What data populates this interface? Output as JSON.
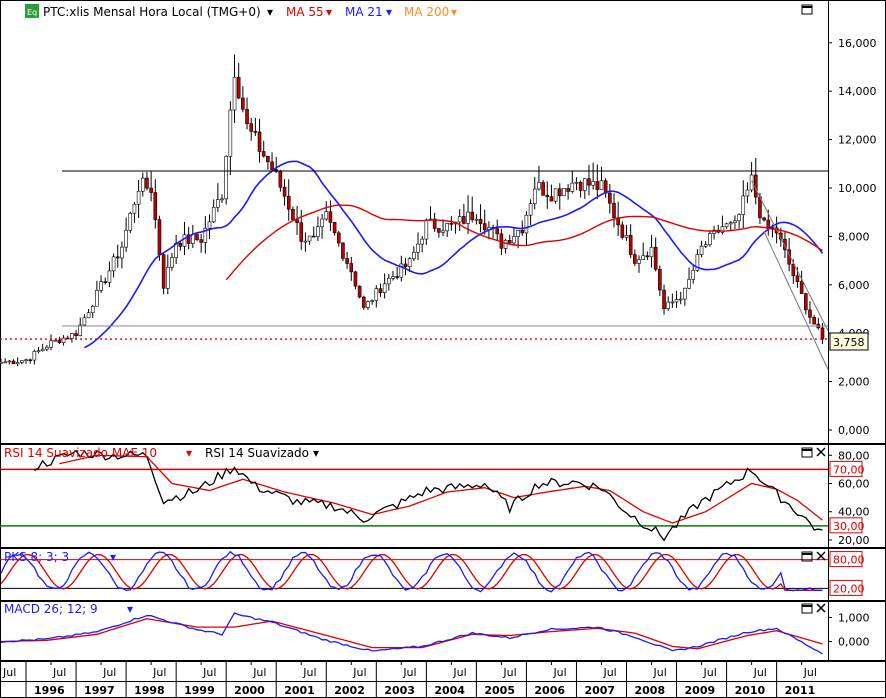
{
  "header": {
    "symbol_badge": "Eq",
    "title": "PTC:xlis Mensal Hora Local (TMG+0)",
    "ma55_label": "MA 55",
    "ma21_label": "MA 21",
    "ma200_label": "MA 200",
    "dropdown_glyph": "▾"
  },
  "price_panel": {
    "last_price_label": "3,758",
    "y_ticks": [
      "16,000",
      "14,000",
      "12,000",
      "10,000",
      "8,000",
      "6,000",
      "4,000",
      "2,000",
      "0,000"
    ]
  },
  "rsi_panel": {
    "label_mae": "RSI 14 Suavizado MAE 10",
    "label_rsi": "RSI 14 Suavizado",
    "y_ticks": [
      "80,00",
      "60,00",
      "40,00",
      "20,00"
    ],
    "levels": [
      "70,00",
      "30,00"
    ]
  },
  "pks_panel": {
    "label": "PKS 8; 3; 3",
    "levels": [
      "80,00",
      "20,00"
    ]
  },
  "macd_panel": {
    "label": "MACD 26; 12; 9",
    "y_ticks": [
      "1,000",
      "0,000"
    ]
  },
  "time_axis": {
    "years": [
      "1996",
      "1997",
      "1998",
      "1999",
      "2000",
      "2001",
      "2002",
      "2003",
      "2004",
      "2005",
      "2006",
      "2007",
      "2008",
      "2009",
      "2010",
      "2011"
    ],
    "mid_year_label": "Jul"
  },
  "colors": {
    "ma55": "#e00000",
    "ma21": "#1a1aff",
    "ma200": "#ff8c1a",
    "candle_up": "#ffffff",
    "candle_down": "#c00000",
    "level_red": "#e00000",
    "level_green": "#008000"
  },
  "chart_data": [
    {
      "type": "candlestick",
      "title": "PTC:xlis Mensal Hora Local (TMG+0)",
      "frequency": "monthly",
      "x_start": "1995-07",
      "x_end": "2011-12",
      "ylim": [
        0,
        16.5
      ],
      "horizontal_lines": [
        10.7,
        4.3,
        3.758
      ],
      "last_price": 3.758,
      "close_anchors": [
        {
          "date": "1995-07",
          "close": 2.8
        },
        {
          "date": "1996-01",
          "close": 2.9
        },
        {
          "date": "1996-07",
          "close": 3.6
        },
        {
          "date": "1997-01",
          "close": 4.0
        },
        {
          "date": "1997-06",
          "close": 5.6
        },
        {
          "date": "1997-12",
          "close": 7.6
        },
        {
          "date": "1998-04",
          "close": 10.1
        },
        {
          "date": "1998-07",
          "close": 10.0
        },
        {
          "date": "1998-10",
          "close": 6.0
        },
        {
          "date": "1999-01",
          "close": 7.8
        },
        {
          "date": "1999-07",
          "close": 7.9
        },
        {
          "date": "1999-12",
          "close": 9.8
        },
        {
          "date": "2000-03",
          "close": 15.0
        },
        {
          "date": "2000-06",
          "close": 12.5
        },
        {
          "date": "2000-12",
          "close": 10.8
        },
        {
          "date": "2001-03",
          "close": 9.7
        },
        {
          "date": "2001-07",
          "close": 8.0
        },
        {
          "date": "2001-10",
          "close": 7.8
        },
        {
          "date": "2002-01",
          "close": 8.8
        },
        {
          "date": "2002-07",
          "close": 6.6
        },
        {
          "date": "2002-10",
          "close": 5.0
        },
        {
          "date": "2003-03",
          "close": 6.1
        },
        {
          "date": "2003-09",
          "close": 6.9
        },
        {
          "date": "2004-01",
          "close": 8.5
        },
        {
          "date": "2004-07",
          "close": 8.4
        },
        {
          "date": "2005-01",
          "close": 9.0
        },
        {
          "date": "2005-07",
          "close": 7.7
        },
        {
          "date": "2005-12",
          "close": 8.4
        },
        {
          "date": "2006-03",
          "close": 10.1
        },
        {
          "date": "2006-07",
          "close": 9.8
        },
        {
          "date": "2007-01",
          "close": 10.3
        },
        {
          "date": "2007-07",
          "close": 10.0
        },
        {
          "date": "2007-12",
          "close": 8.2
        },
        {
          "date": "2008-03",
          "close": 7.1
        },
        {
          "date": "2008-07",
          "close": 7.5
        },
        {
          "date": "2008-10",
          "close": 5.0
        },
        {
          "date": "2009-03",
          "close": 5.7
        },
        {
          "date": "2009-07",
          "close": 7.5
        },
        {
          "date": "2009-12",
          "close": 8.4
        },
        {
          "date": "2010-03",
          "close": 8.4
        },
        {
          "date": "2010-07",
          "close": 10.3
        },
        {
          "date": "2010-10",
          "close": 8.4
        },
        {
          "date": "2011-01",
          "close": 8.2
        },
        {
          "date": "2011-05",
          "close": 6.4
        },
        {
          "date": "2011-09",
          "close": 4.7
        },
        {
          "date": "2011-12",
          "close": 3.758
        }
      ],
      "series": [
        {
          "name": "MA 55",
          "color": "#e00000"
        },
        {
          "name": "MA 21",
          "color": "#1a1aff"
        },
        {
          "name": "MA 200",
          "color": "#ff8c1a"
        }
      ],
      "yticks": [
        0,
        2,
        4,
        6,
        8,
        10,
        12,
        14,
        16
      ]
    },
    {
      "type": "line",
      "title": "RSI 14 Suavizado MAE 10",
      "ylim": [
        15,
        88
      ],
      "levels": [
        70,
        30
      ],
      "series": [
        {
          "name": "RSI 14 Suavizado",
          "color": "#000000",
          "anchors": [
            [
              "1996-03",
              72
            ],
            [
              "1997-01",
              82
            ],
            [
              "1997-09",
              80
            ],
            [
              "1998-06",
              80
            ],
            [
              "1998-10",
              48
            ],
            [
              "1999-06",
              55
            ],
            [
              "2000-03",
              72
            ],
            [
              "2000-08",
              58
            ],
            [
              "2001-06",
              47
            ],
            [
              "2002-03",
              44
            ],
            [
              "2002-10",
              35
            ],
            [
              "2003-06",
              45
            ],
            [
              "2004-01",
              55
            ],
            [
              "2004-08",
              57
            ],
            [
              "2005-03",
              60
            ],
            [
              "2005-09",
              43
            ],
            [
              "2006-04",
              60
            ],
            [
              "2007-01",
              61
            ],
            [
              "2007-07",
              57
            ],
            [
              "2008-01",
              40
            ],
            [
              "2008-10",
              22
            ],
            [
              "2009-06",
              45
            ],
            [
              "2010-07",
              70
            ],
            [
              "2010-12",
              55
            ],
            [
              "2011-06",
              40
            ],
            [
              "2011-12",
              24
            ]
          ]
        },
        {
          "name": "RSI 14 Suavizado MAE 10",
          "color": "#e00000",
          "anchors": [
            [
              "1996-09",
              74
            ],
            [
              "1997-06",
              80
            ],
            [
              "1998-06",
              79
            ],
            [
              "1998-12",
              60
            ],
            [
              "1999-09",
              55
            ],
            [
              "2000-05",
              63
            ],
            [
              "2001-03",
              54
            ],
            [
              "2002-03",
              46
            ],
            [
              "2002-12",
              38
            ],
            [
              "2003-09",
              44
            ],
            [
              "2004-06",
              54
            ],
            [
              "2005-03",
              57
            ],
            [
              "2005-10",
              50
            ],
            [
              "2006-06",
              54
            ],
            [
              "2007-03",
              58
            ],
            [
              "2007-09",
              55
            ],
            [
              "2008-05",
              40
            ],
            [
              "2008-12",
              32
            ],
            [
              "2009-08",
              40
            ],
            [
              "2010-07",
              60
            ],
            [
              "2011-01",
              56
            ],
            [
              "2011-06",
              48
            ],
            [
              "2011-12",
              34
            ]
          ]
        }
      ]
    },
    {
      "type": "line",
      "title": "PKS 8; 3; 3",
      "ylim": [
        0,
        100
      ],
      "levels": [
        80,
        20
      ],
      "series": [
        {
          "name": "PKS %K",
          "color": "#1a1aff"
        },
        {
          "name": "PKS %D",
          "color": "#e00000"
        }
      ]
    },
    {
      "type": "line",
      "title": "MACD 26; 12; 9",
      "ylim": [
        -0.6,
        1.6
      ],
      "series": [
        {
          "name": "MACD",
          "color": "#1a1aff",
          "anchors": [
            [
              "1995-07",
              0.0
            ],
            [
              "1996-06",
              0.1
            ],
            [
              "1997-06",
              0.4
            ],
            [
              "1998-06",
              1.1
            ],
            [
              "1999-06",
              0.5
            ],
            [
              "1999-12",
              0.3
            ],
            [
              "2000-03",
              1.15
            ],
            [
              "2000-12",
              0.8
            ],
            [
              "2001-12",
              0.1
            ],
            [
              "2002-12",
              -0.4
            ],
            [
              "2003-12",
              -0.2
            ],
            [
              "2004-12",
              0.35
            ],
            [
              "2005-09",
              0.15
            ],
            [
              "2006-06",
              0.5
            ],
            [
              "2007-06",
              0.6
            ],
            [
              "2008-03",
              0.2
            ],
            [
              "2008-12",
              -0.4
            ],
            [
              "2009-06",
              -0.2
            ],
            [
              "2010-06",
              0.4
            ],
            [
              "2011-01",
              0.55
            ],
            [
              "2011-12",
              -0.5
            ]
          ]
        },
        {
          "name": "Signal",
          "color": "#e00000",
          "anchors": [
            [
              "1995-07",
              0.0
            ],
            [
              "1996-06",
              0.05
            ],
            [
              "1997-06",
              0.3
            ],
            [
              "1998-06",
              0.95
            ],
            [
              "1999-06",
              0.6
            ],
            [
              "2000-03",
              0.6
            ],
            [
              "2000-12",
              0.85
            ],
            [
              "2001-12",
              0.3
            ],
            [
              "2002-12",
              -0.25
            ],
            [
              "2003-12",
              -0.25
            ],
            [
              "2004-12",
              0.3
            ],
            [
              "2005-09",
              0.25
            ],
            [
              "2006-06",
              0.4
            ],
            [
              "2007-06",
              0.55
            ],
            [
              "2008-03",
              0.35
            ],
            [
              "2008-12",
              -0.2
            ],
            [
              "2009-06",
              -0.3
            ],
            [
              "2010-06",
              0.25
            ],
            [
              "2011-01",
              0.45
            ],
            [
              "2011-12",
              -0.1
            ]
          ]
        }
      ],
      "yticks": [
        0,
        1
      ]
    }
  ]
}
